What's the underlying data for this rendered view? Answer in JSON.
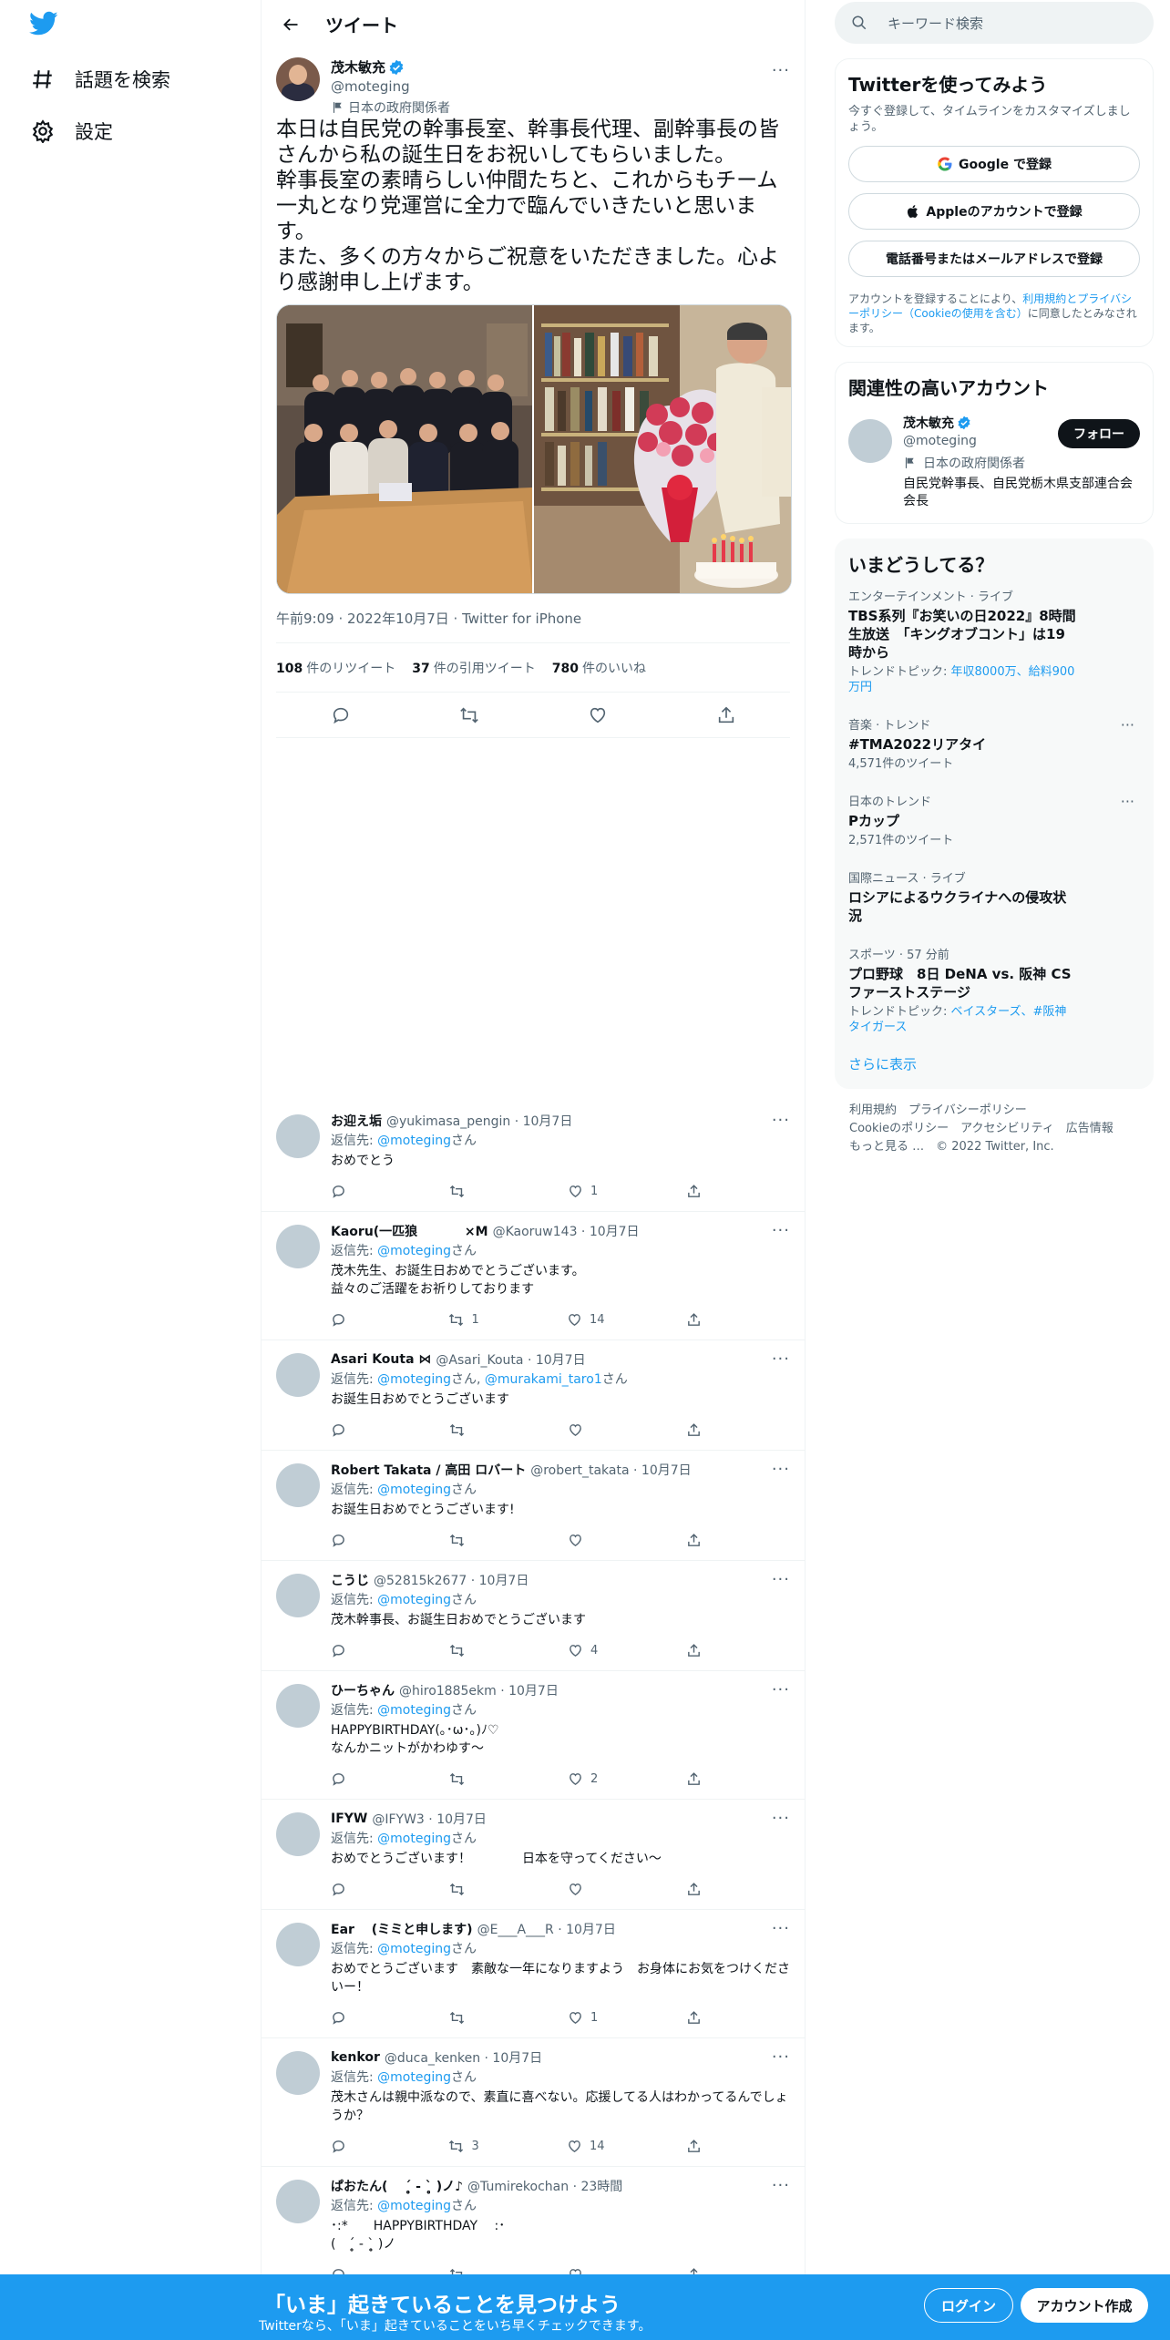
{
  "nav": {
    "explore": "話題を検索",
    "settings": "設定"
  },
  "header": {
    "title": "ツイート"
  },
  "tweet": {
    "name": "茂木敏充",
    "handle": "@moteging",
    "affiliation": "日本の政府関係者",
    "text": "本日は自民党の幹事長室、幹事長代理、副幹事長の皆さんから私の誕生日をお祝いしてもらいました。\n幹事長室の素晴らしい仲間たちと、これからもチーム一丸となり党運営に全力で臨んでいきたいと思います。\nまた、多くの方々からご祝意をいただきました。心より感謝申し上げます。",
    "meta": "午前9:09 · 2022年10月7日 · Twitter for iPhone",
    "stats": {
      "retweets_num": "108",
      "retweets_label": "件のリツイート",
      "quotes_num": "37",
      "quotes_label": "件の引用ツイート",
      "likes_num": "780",
      "likes_label": "件のいいね"
    }
  },
  "reply_to_label": "返信先: ",
  "reply_suffix": "さん",
  "replies": [
    {
      "name": "お迎え垢",
      "handle": "@yukimasa_pengin · 10月7日",
      "to": "@moteging",
      "to2": "",
      "text": "おめでとう",
      "rt": "",
      "like": "1"
    },
    {
      "name": "Kaoru(一匹狼 　　　 ×M",
      "handle": "@Kaoruw143 · 10月7日",
      "to": "@moteging",
      "to2": "",
      "text": "茂木先生、お誕生日おめでとうございます。\n益々のご活躍をお祈りしております",
      "rt": "1",
      "like": "14"
    },
    {
      "name": "Asari Kouta ⋈",
      "handle": "@Asari_Kouta · 10月7日",
      "to": "@moteging",
      "to2": "@murakami_taro1",
      "text": "お誕生日おめでとうございます",
      "rt": "",
      "like": ""
    },
    {
      "name": "Robert Takata / 高田 ロバート",
      "handle": "@robert_takata · 10月7日",
      "to": "@moteging",
      "to2": "",
      "text": "お誕生日おめでとうございます!",
      "rt": "",
      "like": ""
    },
    {
      "name": "こうじ",
      "handle": "@52815k2677 · 10月7日",
      "to": "@moteging",
      "to2": "",
      "text": "茂木幹事長、お誕生日おめでとうございます",
      "rt": "",
      "like": "4"
    },
    {
      "name": "ひーちゃん",
      "handle": "@hiro1885ekm · 10月7日",
      "to": "@moteging",
      "to2": "",
      "text": "HAPPYBIRTHDAY(｡･ω･｡)ﾉ♡\nなんかニットがかわゆす〜",
      "rt": "",
      "like": "2"
    },
    {
      "name": "IFYW",
      "handle": "@IFYW3 · 10月7日",
      "to": "@moteging",
      "to2": "",
      "text": "おめでとうございます！　　　　日本を守ってください〜",
      "rt": "",
      "like": ""
    },
    {
      "name": "Ear 　(ミミと申します)",
      "handle": "@E___A___R · 10月7日",
      "to": "@moteging",
      "to2": "",
      "text": "おめでとうございます　素敵な一年になりますよう　お身体にお気をつけくださいー！",
      "rt": "",
      "like": "1"
    },
    {
      "name": "kenkor",
      "handle": "@duca_kenken · 10月7日",
      "to": "@moteging",
      "to2": "",
      "text": "茂木さんは親中派なので、素直に喜べない。応援してる人はわかってるんでしょうか？",
      "rt": "3",
      "like": "14"
    },
    {
      "name": "ぱおたん( 　ˊ̥̥̥̥̥ - ˋ̥̥̥̥̥ )ノ♪",
      "handle": "@Tumirekochan · 23時間",
      "to": "@moteging",
      "to2": "",
      "text": "･:*　　HAPPYBIRTHDAY　 :･\n(　ˊ̥̥̥̥̥ - ˋ̥̥̥̥̥ )ノ",
      "rt": "",
      "like": ""
    }
  ],
  "right": {
    "search_placeholder": "キーワード検索",
    "signup": {
      "title": "Twitterを使ってみよう",
      "sub": "今すぐ登録して、タイムラインをカスタマイズしましょう。",
      "google": "Google で登録",
      "apple": "Appleのアカウントで登録",
      "phone": "電話番号またはメールアドレスで登録",
      "legal_pre": "アカウントを登録することにより、",
      "legal_link": "利用規約とプライバシーポリシー（Cookieの使用を含む）",
      "legal_post": "に同意したとみなされます。"
    },
    "related": {
      "title": "関連性の高いアカウント",
      "name": "茂木敏充",
      "handle": "@moteging",
      "affiliation": "日本の政府関係者",
      "bio": "自民党幹事長、自民党栃木県支部連合会会長",
      "follow": "フォロー"
    },
    "trends": {
      "title": "いまどうしてる？",
      "items": [
        {
          "cat": "エンターテインメント · ライブ",
          "title": "TBS系列『お笑いの日2022』8時間生放送　「キングオブコント」は19時から",
          "sub_pre": "トレンドトピック: ",
          "sub_link": "年収8000万、給料900万円",
          "dots": false
        },
        {
          "cat": "音楽 · トレンド",
          "title": "#TMA2022リアタイ",
          "sub_pre": "4,571件のツイート",
          "sub_link": "",
          "dots": true
        },
        {
          "cat": "日本のトレンド",
          "title": "Pカップ",
          "sub_pre": "2,571件のツイート",
          "sub_link": "",
          "dots": true
        },
        {
          "cat": "国際ニュース · ライブ",
          "title": "ロシアによるウクライナへの侵攻状況",
          "sub_pre": "",
          "sub_link": "",
          "dots": false
        },
        {
          "cat": "スポーツ · 57 分前",
          "title": "プロ野球　8日 DeNA vs. 阪神 CSファーストステージ",
          "sub_pre": "トレンドトピック: ",
          "sub_link": "ベイスターズ、#阪神タイガース",
          "dots": false
        }
      ],
      "more": "さらに表示"
    },
    "footer": {
      "line1": "利用規約　プライバシーポリシー",
      "line2": "Cookieのポリシー　アクセシビリティ　広告情報",
      "line3": "もっと見る …　© 2022 Twitter, Inc."
    }
  },
  "bottom": {
    "title": "「いま」起きていることを見つけよう",
    "sub": "Twitterなら、「いま」起きていることをいち早くチェックできます。",
    "login": "ログイン",
    "signup": "アカウント作成"
  },
  "colors": {
    "accent": "#1d9bf0",
    "text": "#0f1419",
    "secondary": "#536471"
  }
}
